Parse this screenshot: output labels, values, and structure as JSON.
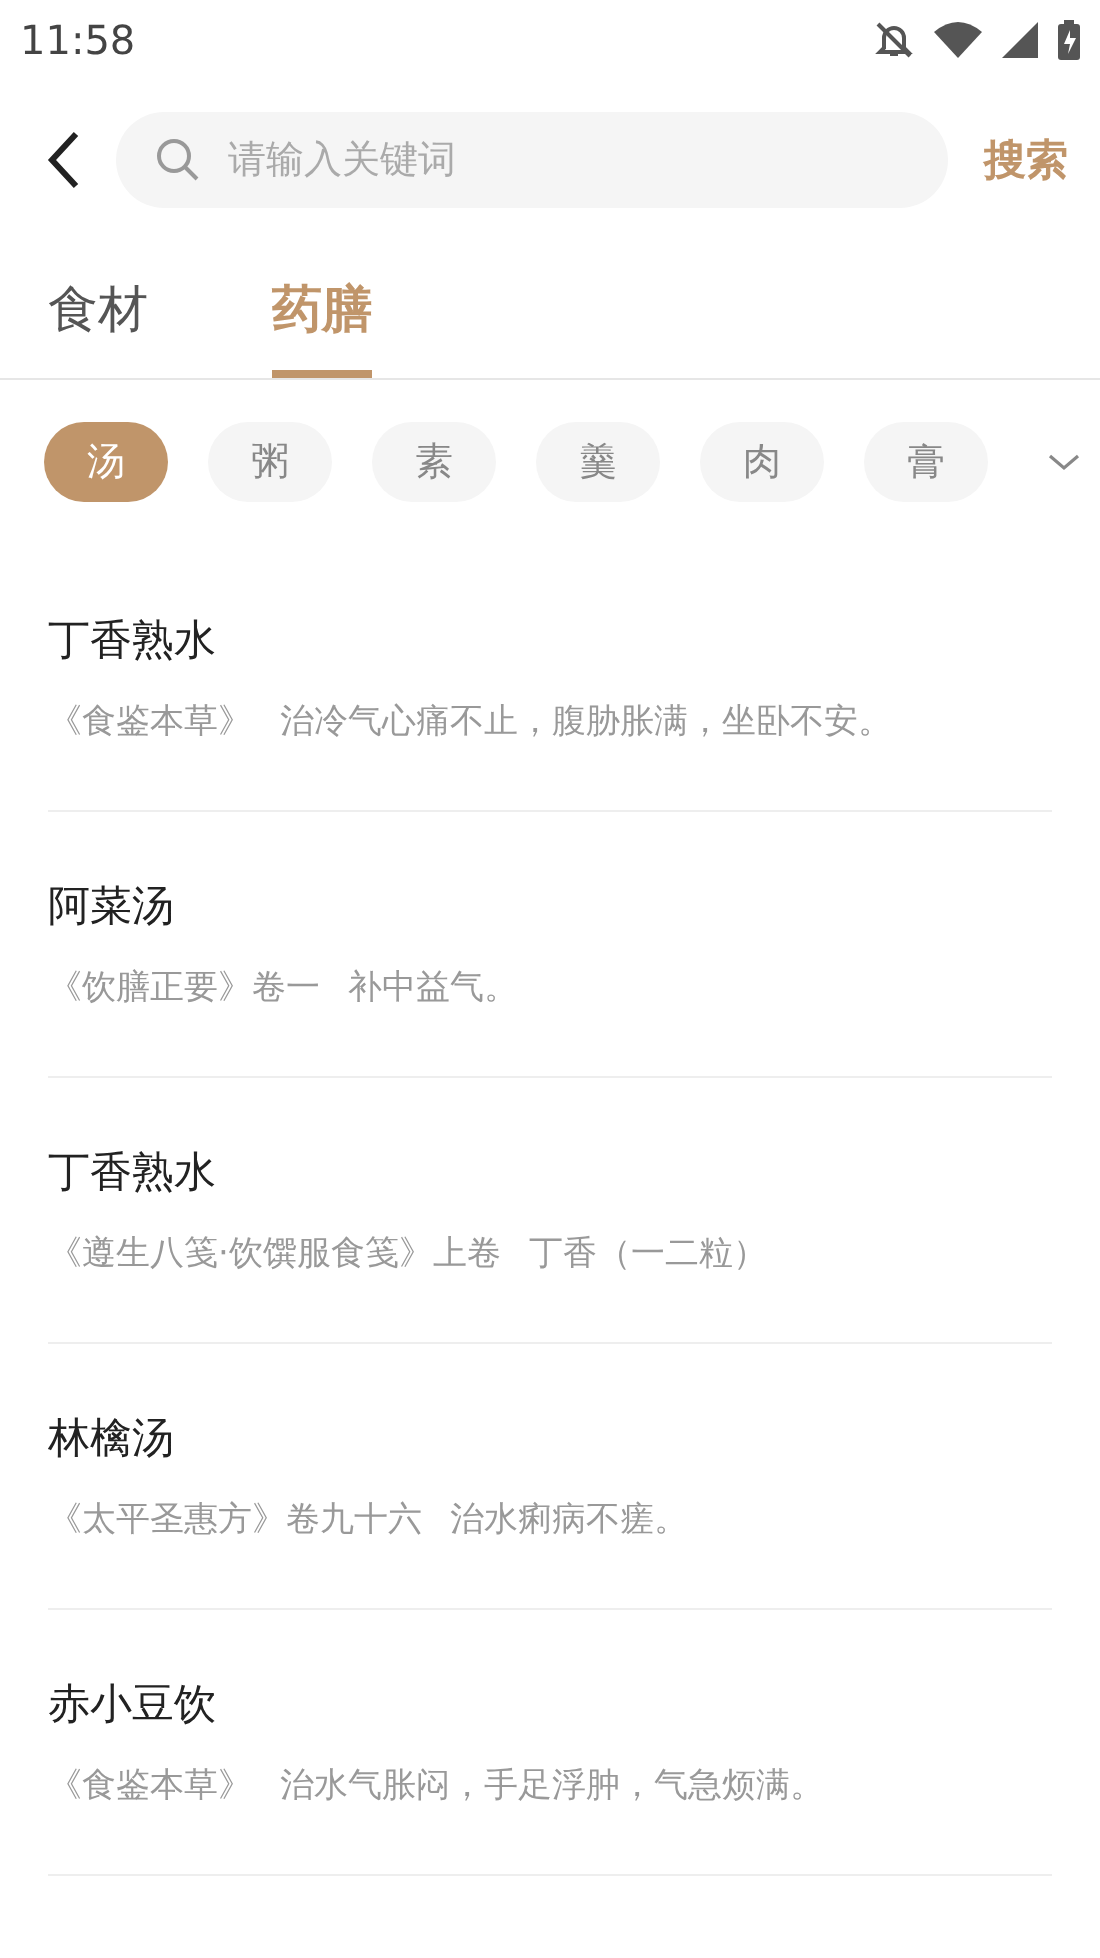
{
  "status_bar": {
    "time": "11:58"
  },
  "search": {
    "placeholder": "请输入关键词",
    "button": "搜索"
  },
  "tabs": [
    {
      "label": "食材",
      "selected": false
    },
    {
      "label": "药膳",
      "selected": true
    }
  ],
  "chips": [
    {
      "label": "汤",
      "selected": true
    },
    {
      "label": "粥",
      "selected": false
    },
    {
      "label": "素",
      "selected": false
    },
    {
      "label": "羹",
      "selected": false
    },
    {
      "label": "肉",
      "selected": false
    },
    {
      "label": "膏",
      "selected": false
    }
  ],
  "items": [
    {
      "title": "丁香熟水",
      "source": "《食鉴本草》",
      "description": "治冷气心痛不止，腹胁胀满，坐卧不安。"
    },
    {
      "title": "阿菜汤",
      "source": "《饮膳正要》卷一",
      "description": "补中益气。"
    },
    {
      "title": "丁香熟水",
      "source": "《遵生八笺·饮馔服食笺》上卷",
      "description": "丁香（一二粒）"
    },
    {
      "title": "林檎汤",
      "source": "《太平圣惠方》卷九十六",
      "description": "治水痢病不瘥。"
    },
    {
      "title": "赤小豆饮",
      "source": "《食鉴本草》",
      "description": "治水气胀闷，手足浮肿，气急烦满。"
    }
  ]
}
